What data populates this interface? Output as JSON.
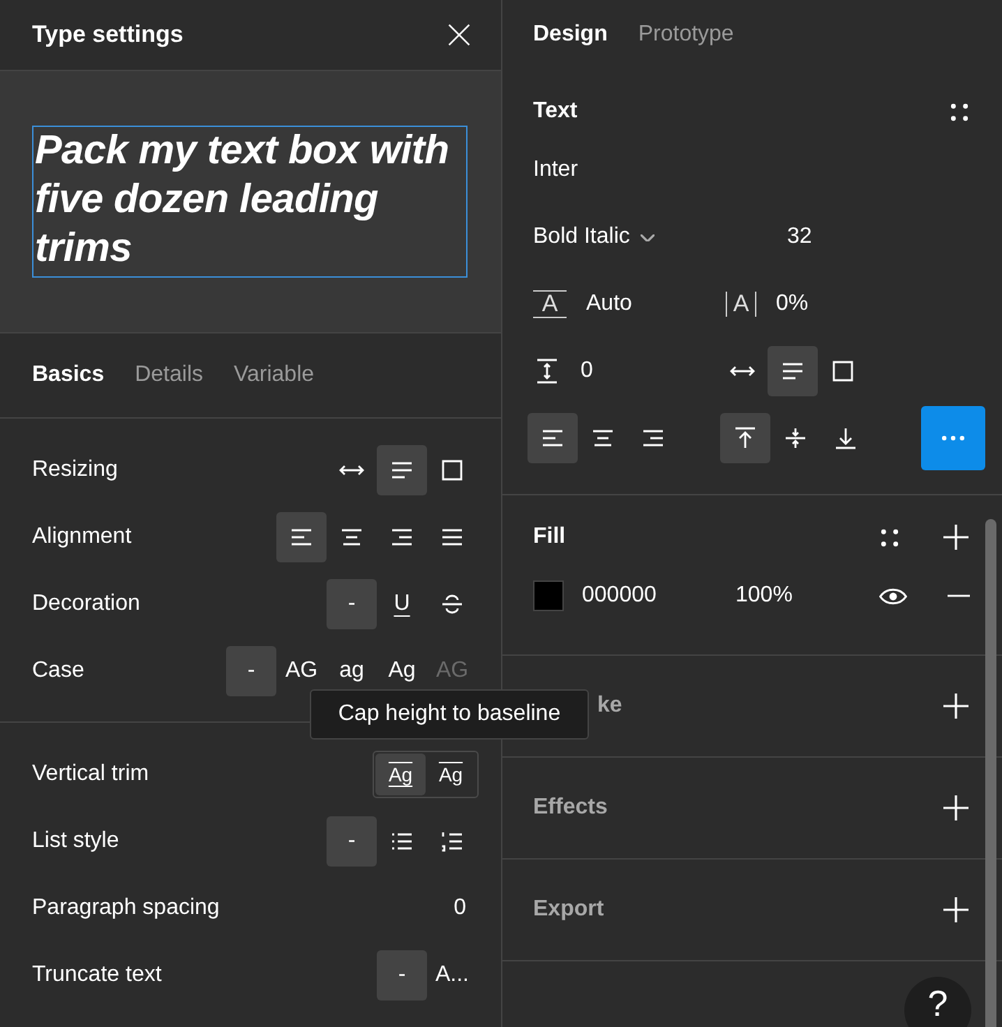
{
  "type_settings": {
    "title": "Type settings",
    "preview_text": "Pack my text box with five dozen leading trims",
    "tabs": [
      {
        "label": "Basics",
        "selected": true
      },
      {
        "label": "Details",
        "selected": false
      },
      {
        "label": "Variable",
        "selected": false
      }
    ],
    "groups": [
      {
        "rows": [
          {
            "kind": "options",
            "label": "Resizing",
            "options": [
              {
                "kind": "icon",
                "selected": false
              },
              {
                "kind": "icon",
                "selected": true
              },
              {
                "kind": "icon",
                "selected": false
              }
            ]
          },
          {
            "kind": "options",
            "label": "Alignment",
            "options": [
              {
                "kind": "icon",
                "selected": true
              },
              {
                "kind": "icon",
                "selected": false
              },
              {
                "kind": "icon",
                "selected": false
              },
              {
                "kind": "icon",
                "selected": false
              }
            ]
          },
          {
            "kind": "options",
            "label": "Decoration",
            "options": [
              {
                "kind": "text",
                "text": "-",
                "selected": true
              },
              {
                "kind": "underline",
                "text": "U",
                "selected": false
              },
              {
                "kind": "icon",
                "selected": false
              }
            ]
          },
          {
            "kind": "options",
            "label": "Case",
            "options": [
              {
                "kind": "text",
                "text": "-",
                "selected": true,
                "disabled": false
              },
              {
                "kind": "text",
                "text": "AG",
                "selected": false,
                "disabled": false
              },
              {
                "kind": "text",
                "text": "ag",
                "selected": false,
                "disabled": false
              },
              {
                "kind": "text",
                "text": "Ag",
                "selected": false,
                "disabled": false
              },
              {
                "kind": "text",
                "text": "AG",
                "selected": false,
                "disabled": true
              }
            ]
          }
        ]
      },
      {
        "rows": [
          {
            "kind": "segmented",
            "label": "Vertical trim",
            "options": [
              {
                "kind": "trim",
                "text": "Ag",
                "selected": true
              },
              {
                "kind": "trim-cap",
                "text": "Ag",
                "selected": false
              }
            ]
          },
          {
            "kind": "options",
            "label": "List style",
            "options": [
              {
                "kind": "text",
                "text": "-",
                "selected": true
              },
              {
                "kind": "icon",
                "selected": false
              },
              {
                "kind": "icon",
                "selected": false
              }
            ]
          },
          {
            "kind": "value",
            "label": "Paragraph spacing",
            "value": "0"
          },
          {
            "kind": "options",
            "label": "Truncate text",
            "options": [
              {
                "kind": "text",
                "text": "-",
                "selected": true
              },
              {
                "kind": "text",
                "text": "A...",
                "selected": false
              }
            ]
          }
        ]
      }
    ],
    "tooltip": "Cap height to baseline"
  },
  "design_panel": {
    "tabs": [
      {
        "label": "Design",
        "selected": true
      },
      {
        "label": "Prototype",
        "selected": false
      }
    ],
    "text": {
      "title": "Text",
      "font": "Inter",
      "style": "Bold Italic",
      "size": "32",
      "line_height": {
        "icon_text": "A",
        "value": "Auto"
      },
      "letter_spacing": {
        "icon_text": "A",
        "value": "0%"
      },
      "paragraph_spacing": "0",
      "resizing": [
        {
          "selected": false
        },
        {
          "selected": true
        },
        {
          "selected": false
        }
      ],
      "align": [
        {
          "selected": true
        },
        {
          "selected": false
        },
        {
          "selected": false
        }
      ],
      "vertical_align": [
        {
          "selected": true
        },
        {
          "selected": false
        },
        {
          "selected": false
        }
      ]
    },
    "fill": {
      "title": "Fill",
      "color": "#000000",
      "hex": "000000",
      "opacity": "100%"
    },
    "sections": [
      {
        "title": "ke"
      },
      {
        "title": "Effects"
      },
      {
        "title": "Export"
      }
    ],
    "help": "?"
  }
}
